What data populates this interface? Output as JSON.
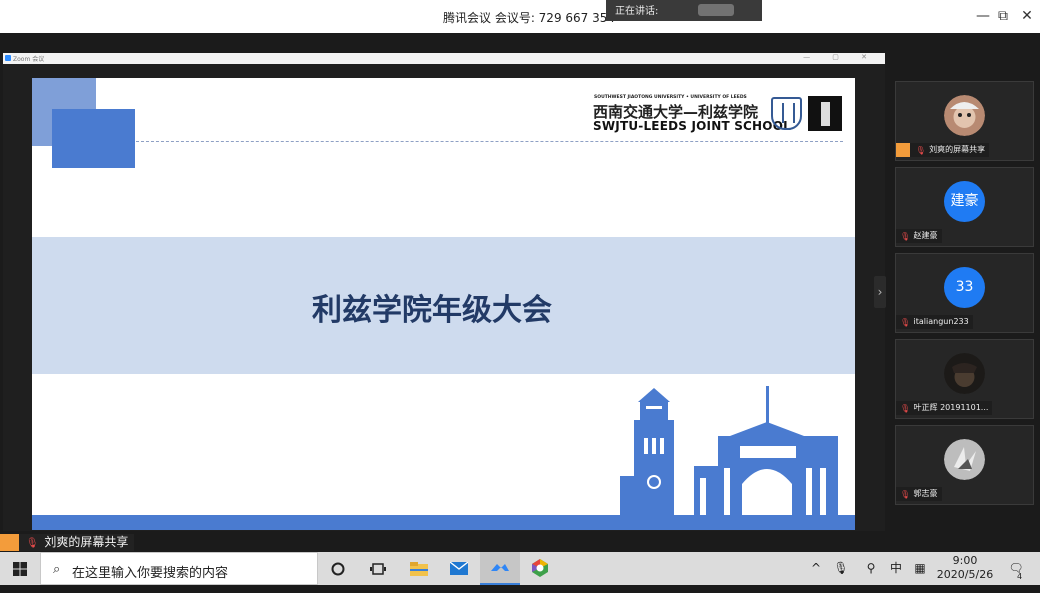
{
  "titlebar": {
    "meeting_info": "腾讯会议 会议号: 729 667 354",
    "speaking_label": "正在讲话:",
    "minimize": "—",
    "restore": "⧉",
    "close": "✕"
  },
  "shared_window": {
    "title": "Zoom 会议",
    "controls": "— ▢ ✕"
  },
  "slide": {
    "university_small": "SOUTHWEST JIAOTONG UNIVERSITY • UNIVERSITY OF LEEDS",
    "university_cn": "西南交通大学—利兹学院",
    "university_en": "SWJTU-LEEDS JOINT SCHOOL",
    "title": "利兹学院年级大会"
  },
  "sidebar_expand": "›",
  "participants": [
    {
      "name": "刘爽的屏幕共享",
      "avatar_type": "photo",
      "sharing": true
    },
    {
      "name": "赵建豪",
      "avatar_type": "initials",
      "initials": "建豪"
    },
    {
      "name": "italiangun233",
      "avatar_type": "initials",
      "initials": "33"
    },
    {
      "name": "叶正辉 20191101...",
      "avatar_type": "photo"
    },
    {
      "name": "郭志豪",
      "avatar_type": "photo"
    }
  ],
  "share_label": "刘爽的屏幕共享",
  "taskbar": {
    "search_placeholder": "在这里输入你要搜索的内容",
    "tray_ime": "中",
    "time": "9:00",
    "date": "2020/5/26",
    "notification_count": "4"
  },
  "colors": {
    "accent_blue": "#4a7bd0",
    "avatar_blue": "#1f7bf3",
    "share_orange": "#f39c3b",
    "title_navy": "#223a66"
  }
}
